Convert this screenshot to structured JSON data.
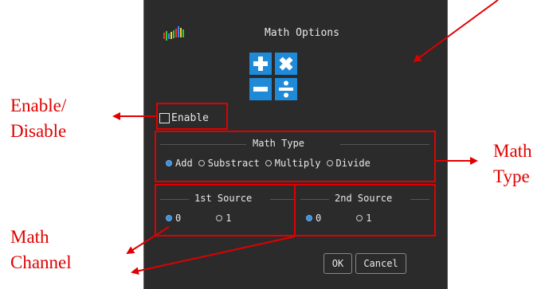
{
  "dialog": {
    "title": "Math Options",
    "enable_label": "Enable",
    "math_type": {
      "title": "Math Type",
      "options": [
        "Add",
        "Substract",
        "Multiply",
        "Divide"
      ],
      "selected": "Add"
    },
    "source1": {
      "title": "1st Source",
      "options": [
        "0",
        "1"
      ],
      "selected": "0"
    },
    "source2": {
      "title": "2nd Source",
      "options": [
        "0",
        "1"
      ],
      "selected": "0"
    },
    "ok_label": "OK",
    "cancel_label": "Cancel"
  },
  "annotations": {
    "enable_line1": "Enable/",
    "enable_line2": "Disable",
    "type_line1": "Math",
    "type_line2": "Type",
    "channel_line1": "Math",
    "channel_line2": "Channel"
  },
  "colors": {
    "dialog_bg": "#2b2b2b",
    "accent_blue": "#1e8ad8",
    "annotation_red": "#e00000"
  },
  "icons": [
    "logo-bars-icon",
    "math-operations-icon",
    "checkbox-icon",
    "radio-icon"
  ]
}
